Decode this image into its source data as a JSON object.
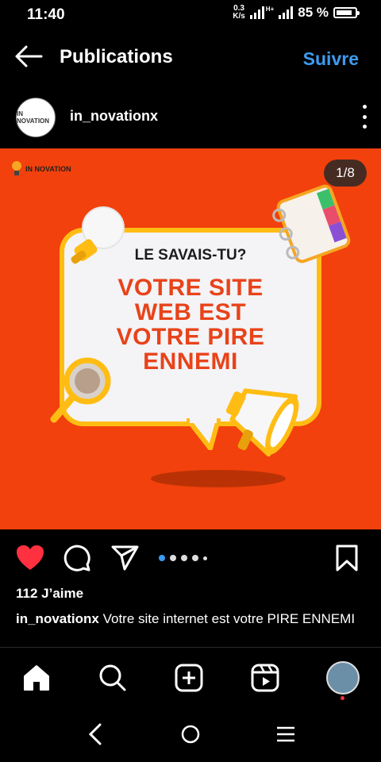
{
  "status_bar": {
    "time": "11:40",
    "net_speed_top": "0.3",
    "net_speed_bottom": "K/s",
    "signal2_label": "H+",
    "battery_percent": "85 %",
    "battery_level": 0.85
  },
  "header": {
    "back_icon": "arrow-left-icon",
    "title": "Publications",
    "follow_label": "Suivre"
  },
  "post_author": {
    "username": "in_novationx",
    "avatar_text": "IN NOVATION"
  },
  "post": {
    "logo_text": "IN NOVATION",
    "page_counter": "1/8",
    "kicker": "LE SAVAIS-TU?",
    "headline_lines": [
      "VOTRE SITE",
      "WEB EST",
      "VOTRE PIRE",
      "ENNEMI"
    ],
    "background_color": "#f2410c",
    "bubble_border_color": "#ffbd14",
    "headline_color": "#e8431a"
  },
  "actions": {
    "like_icon": "heart-filled-icon",
    "comment_icon": "comment-icon",
    "share_icon": "send-icon",
    "save_icon": "bookmark-icon",
    "carousel_total": 5,
    "carousel_active": 0
  },
  "likes_text": "112 J’aime",
  "caption": {
    "username": "in_novationx",
    "text": "Votre site internet est votre PIRE ENNEMI"
  },
  "bottom_nav": [
    "home-icon",
    "search-icon",
    "create-icon",
    "reels-icon",
    "profile-avatar"
  ],
  "system_nav": [
    "back-icon",
    "home-circle-icon",
    "recents-icon"
  ],
  "accent_color": "#3d9bf0"
}
